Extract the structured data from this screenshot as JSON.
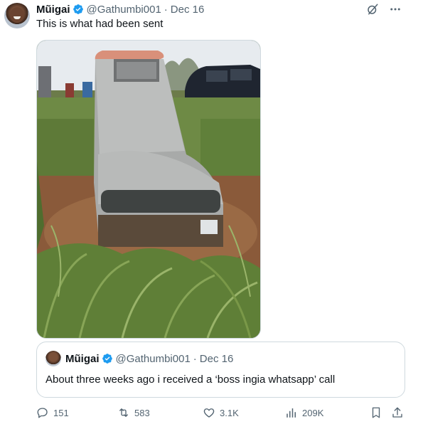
{
  "tweet": {
    "author_name": "Mũigai",
    "handle": "@Gathumbi001",
    "separator": "·",
    "date": "Dec 16",
    "text": "This is what had been sent"
  },
  "quote": {
    "author_name": "Mũigai",
    "handle": "@Gathumbi001",
    "separator": "·",
    "date": "Dec 16",
    "text": "About three weeks ago i received a ‘boss ingia whatsapp’ call"
  },
  "actions": {
    "replies": "151",
    "retweets": "583",
    "likes": "3.1K",
    "views": "209K"
  },
  "icons": {
    "verified": "verified-badge-icon",
    "grok": "grok-icon",
    "more": "more-icon",
    "reply": "reply-icon",
    "retweet": "retweet-icon",
    "like": "like-icon",
    "views": "views-icon",
    "bookmark": "bookmark-icon",
    "share": "share-icon"
  },
  "colors": {
    "verified": "#1d9bf0",
    "text": "#0f1419",
    "secondary": "#536471",
    "border": "#cfd9de"
  }
}
